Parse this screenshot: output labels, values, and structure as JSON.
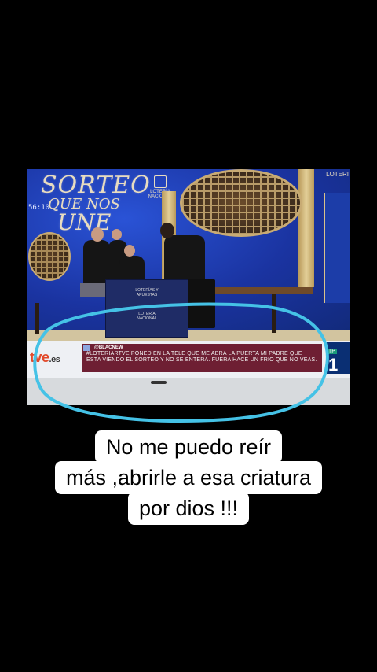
{
  "tv": {
    "logo_lines": [
      "SORTEO",
      "QUE NOS",
      "UNE"
    ],
    "clock": "56:10",
    "loteria_brand": "LOTERÍA NACIONAL",
    "corner_label": "LOTERI",
    "podium_tag": "LOTERÍAS Y APUESTAS",
    "podium_tag2": "LOTERÍA NACIONAL",
    "ticker": {
      "channel": "tve",
      "channel_suffix": ".es",
      "handle": "@BLACNEW",
      "message": "#LOTERIARTVE PONED EN LA TELE QUE ME ABRA LA PUERTA MI PADRE QUE ESTA VIENDO EL SORTEO Y NO SE ENTERA. FUERA HACE UN FRIO QUE NO VEAS.",
      "live_tag": "TP",
      "live_number": "1"
    }
  },
  "highlight": {
    "color": "#45c2e6"
  },
  "caption": {
    "lines": [
      "No me puedo reír",
      "más ,abrirle a esa criatura",
      "por dios !!!"
    ]
  }
}
